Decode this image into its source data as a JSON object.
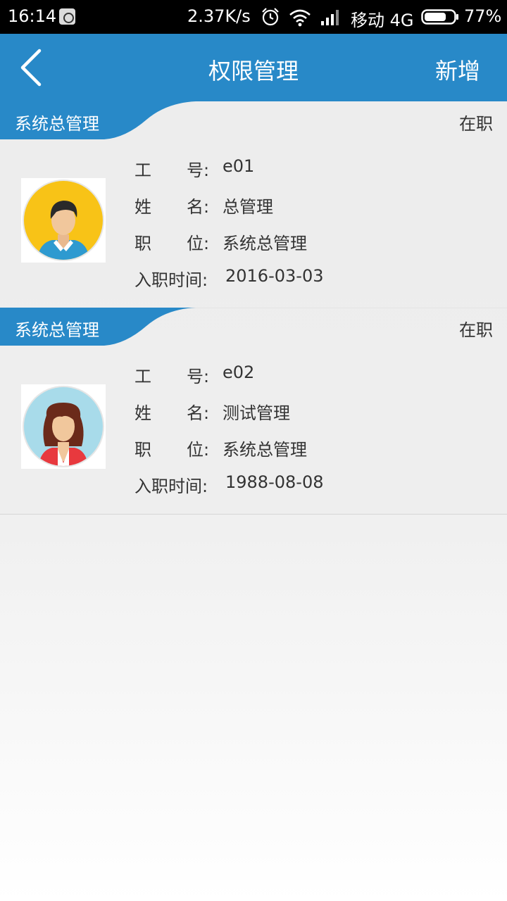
{
  "status_bar": {
    "time": "16:14",
    "net_speed": "2.37K/s",
    "carrier": "移动 4G",
    "battery": "77%",
    "battery_level": 0.77,
    "icons": [
      "app-notification-icon",
      "alarm-icon",
      "wifi-icon",
      "signal-icon",
      "battery-icon"
    ]
  },
  "header": {
    "title": "权限管理",
    "add_label": "新增",
    "background": "#2889c8"
  },
  "labels": {
    "id_start": "工",
    "id_end": "号:",
    "name_start": "姓",
    "name_end": "名:",
    "position_start": "职",
    "position_end": "位:",
    "hire_date": "入职时间:"
  },
  "employees": [
    {
      "role": "系统总管理",
      "status": "在职",
      "id": "e01",
      "name": "总管理",
      "position": "系统总管理",
      "hire_date": "2016-03-03",
      "avatar": "male-avatar-icon"
    },
    {
      "role": "系统总管理",
      "status": "在职",
      "id": "e02",
      "name": "测试管理",
      "position": "系统总管理",
      "hire_date": "1988-08-08",
      "avatar": "female-avatar-icon"
    }
  ]
}
